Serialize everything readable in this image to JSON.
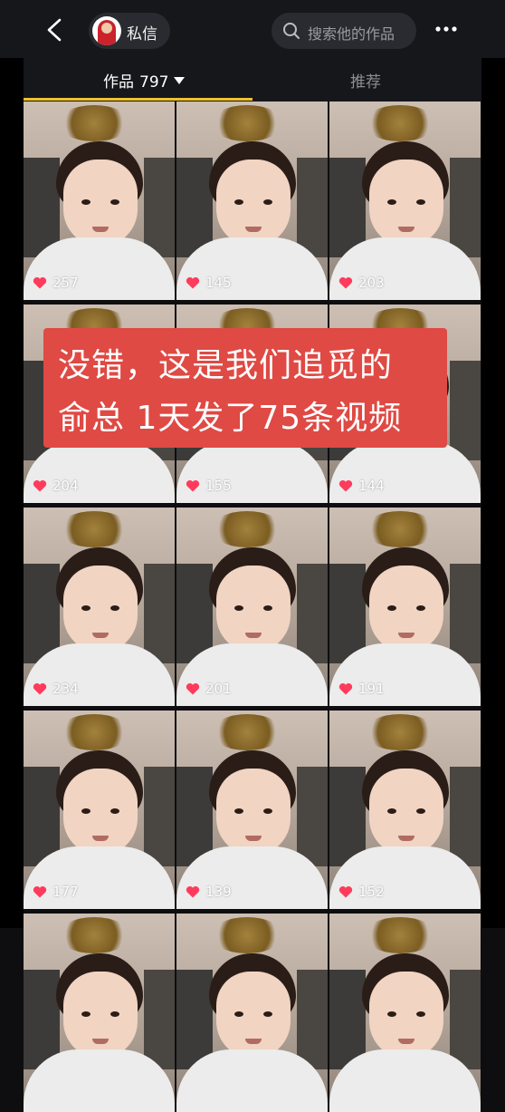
{
  "header": {
    "dm_label": "私信",
    "search_placeholder": "搜索他的作品"
  },
  "tabs": {
    "works_label": "作品",
    "works_count": "797",
    "recommend_label": "推荐"
  },
  "caption": {
    "line1": "没错，这是我们追觅的",
    "line2": "俞总 1天发了75条视频"
  },
  "videos": [
    {
      "likes": "257"
    },
    {
      "likes": "145"
    },
    {
      "likes": "203"
    },
    {
      "likes": "204"
    },
    {
      "likes": "155"
    },
    {
      "likes": "144"
    },
    {
      "likes": "234"
    },
    {
      "likes": "201"
    },
    {
      "likes": "191"
    },
    {
      "likes": "177"
    },
    {
      "likes": "139"
    },
    {
      "likes": "152"
    }
  ],
  "colors": {
    "accent_underline": "#f1c02c",
    "caption_bg": "#df4a44",
    "heart": "#ff3b5c"
  }
}
